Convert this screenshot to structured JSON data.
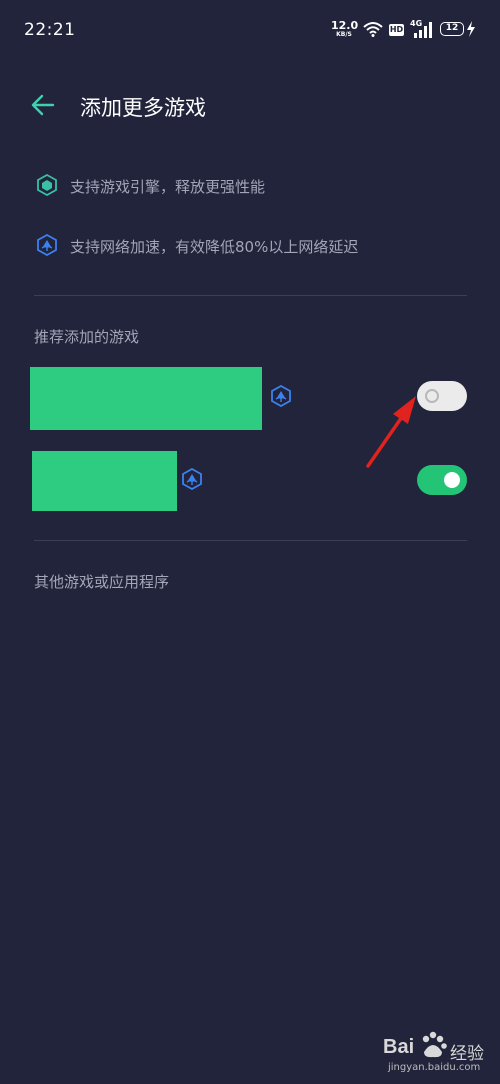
{
  "status_bar": {
    "time": "22:21",
    "net_speed": "12.0",
    "net_unit": "KB/S",
    "hd": "HD",
    "signal_label": "4G",
    "battery": "12"
  },
  "header": {
    "back_icon": "arrow-left-icon",
    "title": "添加更多游戏"
  },
  "features": [
    {
      "icon": "game-engine-icon",
      "text": "支持游戏引擎，释放更强性能"
    },
    {
      "icon": "network-accel-icon",
      "text": "支持网络加速，有效降低80%以上网络延迟"
    }
  ],
  "recommended": {
    "title": "推荐添加的游戏",
    "games": [
      {
        "engine_icon": "network-accel-icon",
        "enabled": false
      },
      {
        "engine_icon": "network-accel-icon",
        "enabled": true
      }
    ]
  },
  "other_section": {
    "title": "其他游戏或应用程序"
  },
  "watermark": {
    "brand": "Bai",
    "brand_suffix": "经验",
    "url": "jingyan.baidu.com"
  },
  "colors": {
    "background": "#21243a",
    "game_block": "#2ecc80",
    "toggle_on": "#23c475",
    "toggle_off": "#ebebeb",
    "accent_back": "#3fd0b0",
    "annotation_arrow": "#e0231f"
  }
}
